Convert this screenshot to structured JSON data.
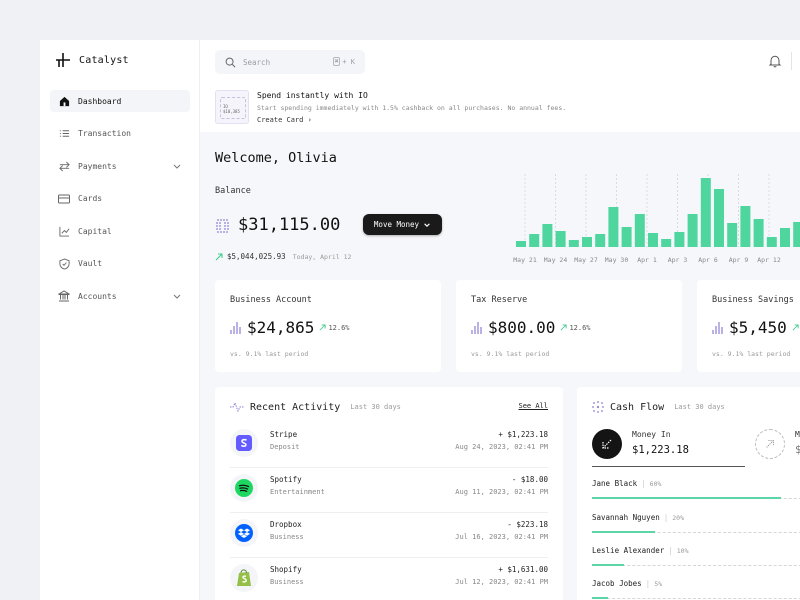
{
  "brand": {
    "name": "Catalyst"
  },
  "sidebar": {
    "items": [
      {
        "label": "Dashboard",
        "icon": "home-icon",
        "active": true
      },
      {
        "label": "Transaction",
        "icon": "list-icon"
      },
      {
        "label": "Payments",
        "icon": "arrows-icon",
        "has_children": true
      },
      {
        "label": "Cards",
        "icon": "card-icon"
      },
      {
        "label": "Capital",
        "icon": "trend-icon"
      },
      {
        "label": "Vault",
        "icon": "shield-icon"
      },
      {
        "label": "Accounts",
        "icon": "bank-icon",
        "has_children": true
      }
    ]
  },
  "search": {
    "placeholder": "Search",
    "shortcut_key": "⌘",
    "shortcut_rest": "+ K"
  },
  "promo": {
    "title": "Spend instantly with IO",
    "subtitle": "Start spending immediately with 1.5% cashback on all purchases. No annual fees.",
    "link": "Create Card ›",
    "card_text": "IO $10,385"
  },
  "welcome": "Welcome, Olivia",
  "balance": {
    "label": "Balance",
    "value": "$31,115.00",
    "move_button": "Move Money",
    "sub_value": "$5,044,025.93",
    "sub_date": "Today, April 12"
  },
  "chart_data": {
    "type": "bar",
    "x_labels": [
      "May 21",
      "May 24",
      "May 27",
      "May 30",
      "Apr 1",
      "Apr 3",
      "Apr 6",
      "Apr 9",
      "Apr 12"
    ],
    "values": [
      6,
      13,
      23,
      16,
      7,
      10,
      13,
      40,
      20,
      33,
      14,
      8,
      15,
      33,
      69,
      58,
      24,
      41,
      28,
      10,
      19,
      25,
      23
    ],
    "ylim": [
      0,
      70
    ],
    "color": "#4fd69f",
    "grid": false
  },
  "stats": [
    {
      "title": "Business Account",
      "value": "$24,865",
      "pct": "12.6%",
      "foot": "vs. 9.1% last period"
    },
    {
      "title": "Tax Reserve",
      "value": "$800.00",
      "pct": "12.6%",
      "foot": "vs. 9.1% last period"
    },
    {
      "title": "Business Savings",
      "value": "$5,450",
      "pct": "",
      "foot": "vs. 9.1% last period"
    }
  ],
  "activity": {
    "title": "Recent Activity",
    "period": "Last 30 days",
    "see_all": "See All",
    "rows": [
      {
        "name": "Stripe",
        "category": "Deposit",
        "amount": "+ $1,223.18",
        "date": "Aug 24, 2023, 02:41 PM",
        "icon": "stripe-icon"
      },
      {
        "name": "Spotify",
        "category": "Entertainment",
        "amount": "- $18.00",
        "date": "Aug 11, 2023, 02:41 PM",
        "icon": "spotify-icon"
      },
      {
        "name": "Dropbox",
        "category": "Business",
        "amount": "- $223.18",
        "date": "Jul 16, 2023, 02:41 PM",
        "icon": "dropbox-icon"
      },
      {
        "name": "Shopify",
        "category": "Business",
        "amount": "+ $1,631.00",
        "date": "Jul 12, 2023, 02:41 PM",
        "icon": "shopify-icon"
      }
    ]
  },
  "cashflow": {
    "title": "Cash Flow",
    "period": "Last 30 days",
    "money_in_label": "Money In",
    "money_in_value": "$1,223.18",
    "money_out_label_fragment": "M",
    "money_out_value_fragment": "$",
    "people": [
      {
        "name": "Jane Black",
        "pct": "60%",
        "fraction": 0.84
      },
      {
        "name": "Savannah Nguyen",
        "pct": "20%",
        "fraction": 0.28
      },
      {
        "name": "Leslie Alexander",
        "pct": "10%",
        "fraction": 0.14
      },
      {
        "name": "Jacob Jobes",
        "pct": "5%",
        "fraction": 0.07
      }
    ]
  }
}
